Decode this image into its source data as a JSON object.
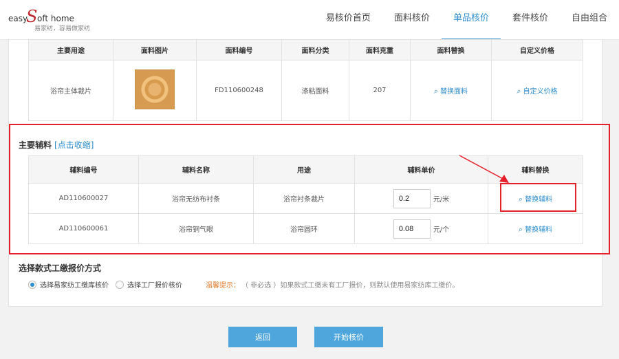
{
  "logo": {
    "easy": "easy",
    "s": "S",
    "oft": "oft home",
    "slogan": "易家纺，容易做家纺"
  },
  "nav": [
    {
      "label": "易核价首页"
    },
    {
      "label": "面料核价"
    },
    {
      "label": "单品核价"
    },
    {
      "label": "套件核价"
    },
    {
      "label": "自由组合"
    }
  ],
  "nav_active_index": 2,
  "fabric": {
    "headers": [
      "主要用途",
      "面料图片",
      "面料编号",
      "面料分类",
      "面料克重",
      "面料替换",
      "自定义价格"
    ],
    "row": {
      "usage": "浴帘主体裁片",
      "code": "FD110600248",
      "category": "涤粘面料",
      "weight": "207",
      "replace_link": "替换面料",
      "custom_price_link": "自定义价格"
    }
  },
  "aux": {
    "title": "主要辅料",
    "toggle": "[点击收缩]",
    "headers": [
      "辅料编号",
      "辅料名称",
      "用途",
      "辅料单价",
      "辅料替换"
    ],
    "rows": [
      {
        "code": "AD110600027",
        "name": "浴帘无纺布衬条",
        "usage": "浴帘衬条裁片",
        "price": "0.2",
        "unit": "元/米",
        "replace": "替换辅料"
      },
      {
        "code": "AD110600061",
        "name": "浴帘铜气眼",
        "usage": "浴帘圆环",
        "price": "0.08",
        "unit": "元/个",
        "replace": "替换辅料"
      }
    ]
  },
  "quote": {
    "title": "选择款式工缴报价方式",
    "option1": "选择易家纺工缴库核价",
    "option2": "选择工厂报价核价",
    "tip_label": "温馨提示：",
    "tip_text": "（ 非必选 ）如果款式工缴未有工厂报价，则默认使用易家纺库工缴价。"
  },
  "buttons": {
    "back": "返回",
    "start": "开始核价"
  },
  "colors": {
    "accent": "#2e8ece",
    "button": "#4ea6dc",
    "highlight": "#e5202b",
    "tip": "#e07b2a"
  }
}
